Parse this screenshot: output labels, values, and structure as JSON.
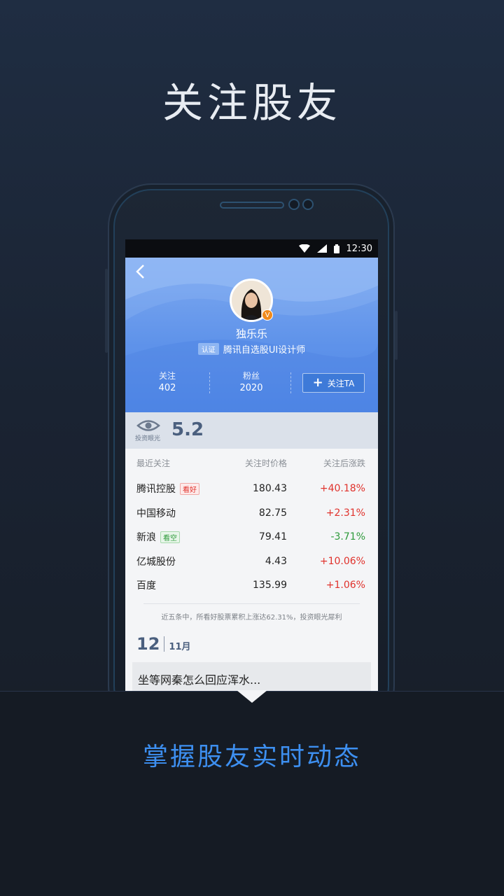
{
  "headline": "关注股友",
  "subheadline": "掌握股友实时动态",
  "status_bar": {
    "time": "12:30"
  },
  "profile": {
    "name": "独乐乐",
    "verified_badge": "V",
    "cert_tag": "认证",
    "cert_title": "腾讯自选股UI设计师",
    "following_label": "关注",
    "following_count": "402",
    "fans_label": "粉丝",
    "fans_count": "2020",
    "follow_button": "关注TA"
  },
  "score": {
    "label": "投资眼光",
    "value": "5.2"
  },
  "table": {
    "headers": [
      "最近关注",
      "关注时价格",
      "关注后涨跌"
    ],
    "rows": [
      {
        "name": "腾讯控股",
        "tag": "看好",
        "tag_type": "good",
        "price": "180.43",
        "change": "+40.18%",
        "dir": "up"
      },
      {
        "name": "中国移动",
        "tag": "",
        "tag_type": "",
        "price": "82.75",
        "change": "+2.31%",
        "dir": "up"
      },
      {
        "name": "新浪",
        "tag": "看空",
        "tag_type": "bad",
        "price": "79.41",
        "change": "-3.71%",
        "dir": "down"
      },
      {
        "name": "亿城股份",
        "tag": "",
        "tag_type": "",
        "price": "4.43",
        "change": "+10.06%",
        "dir": "up"
      },
      {
        "name": "百度",
        "tag": "",
        "tag_type": "",
        "price": "135.99",
        "change": "+1.06%",
        "dir": "up"
      }
    ],
    "note": "近五条中，所看好股票累积上涨达62.31%，投资眼光犀利"
  },
  "feed": {
    "day": "12",
    "month": "11月",
    "post_title": "坐等网秦怎么回应浑水..."
  },
  "icons": [
    "back-icon",
    "wifi-icon",
    "signal-icon",
    "battery-icon",
    "eye-icon",
    "plus-icon"
  ],
  "colors": {
    "accent": "#3d8ff0",
    "up": "#e0322c",
    "down": "#2d9a3a",
    "profile_bg": "#5f93ea"
  }
}
